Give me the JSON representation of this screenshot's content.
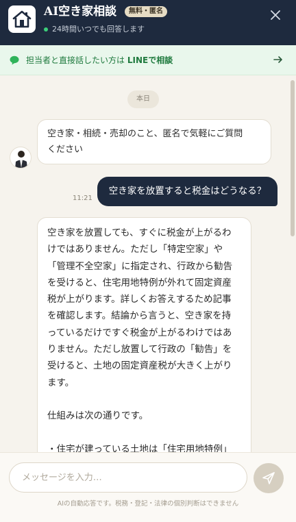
{
  "header": {
    "title": "AI空き家相談",
    "badge": "無料・匿名",
    "status": "24時間いつでも回答します",
    "icons": {
      "logo": "house-icon",
      "close": "close-icon"
    }
  },
  "line_banner": {
    "prefix": "担当者と直接話したい方は",
    "emphasis": "LINEで相談",
    "icons": {
      "left": "chat-bubble-icon",
      "right": "arrow-right-icon"
    }
  },
  "conversation": {
    "date_label": "本日",
    "bot_greeting": [
      "空き家・相続・売却のこと、匿名で気軽にご質問",
      "ください"
    ],
    "user_message": "空き家を放置すると税金はどうなる？",
    "user_time": "11:21",
    "bot_answer": [
      "空き家を放置しても、すぐに税金が上がるわ",
      "けではありません。ただし「特定空家」や",
      "「管理不全空家」に指定され、行政から勧告",
      "を受けると、住宅用地特例が外れて固定資産",
      "税が上がります。詳しくお答えするため記事",
      "を確認します。結論から言うと、空き家を持",
      "っているだけですぐ税金が上がるわけではあ",
      "りません。ただし放置して行政の「勧告」を",
      "受けると、土地の固定資産税が大きく上がり",
      "ます。",
      "",
      "仕組みは次の通りです。",
      "",
      "・住宅が建っている土地は「住宅用地特例」"
    ]
  },
  "composer": {
    "placeholder": "メッセージを入力…",
    "send_icon": "send-icon",
    "disclaimer": "AIの自動応答です。税務・登記・法律の個別判断はできません"
  },
  "colors": {
    "header_bg": "#1e2a3e",
    "badge_bg": "#e6dcc4",
    "line_green": "#1f7a3e",
    "status_green": "#3ccf7a",
    "user_bubble": "#1e2a3e",
    "send_button": "#d6cfc1"
  }
}
